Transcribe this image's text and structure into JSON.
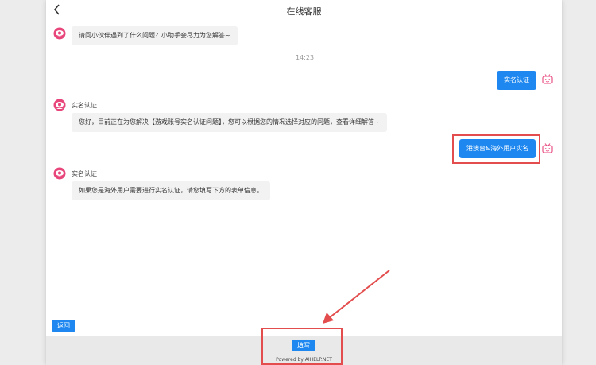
{
  "header": {
    "title": "在线客服"
  },
  "messages": {
    "greeting": "请问小伙伴遇到了什么问题？小助手会尽力为您解答~",
    "time": "14:23",
    "user1": "实名认证",
    "reply1": {
      "name": "实名认证",
      "text": "您好，目前正在为您解决【游戏账号实名认证问题】，您可以根据您的情况选择对应的问题，查看详细解答~"
    },
    "user2": "港澳台&海外用户实名",
    "reply2": {
      "name": "实名认证",
      "text": "如果您是海外用户需要进行实名认证，请您填写下方的表单信息。"
    }
  },
  "controls": {
    "back_label": "返回",
    "fill_label": "填写"
  },
  "footer": {
    "powered": "Powered by AIHELP.NET"
  },
  "colors": {
    "accent": "#1e88f0",
    "highlight": "#e34d4d",
    "bot_avatar": "#e8457b"
  }
}
